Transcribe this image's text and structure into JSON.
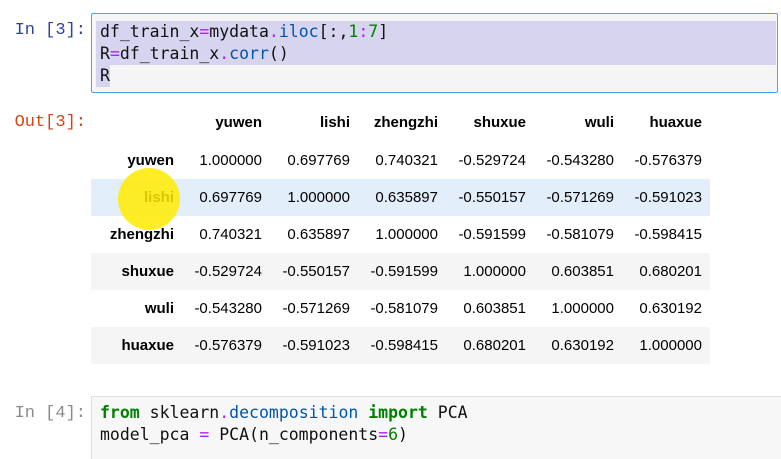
{
  "cells": [
    {
      "in_prompt": "In [3]:",
      "code_lines": [
        [
          "df_train_x",
          "=",
          "mydata",
          ".",
          "iloc",
          "[:,",
          "1",
          ":",
          "7",
          "]"
        ],
        [
          "R",
          "=",
          "df_train_x",
          ".",
          "corr",
          "()"
        ],
        [
          "R"
        ]
      ],
      "out_prompt": "Out[3]:",
      "output": {
        "columns": [
          "yuwen",
          "lishi",
          "zhengzhi",
          "shuxue",
          "wuli",
          "huaxue"
        ],
        "rows": [
          {
            "index": "yuwen",
            "values": [
              "1.000000",
              "0.697769",
              "0.740321",
              "-0.529724",
              "-0.543280",
              "-0.576379"
            ]
          },
          {
            "index": "lishi",
            "values": [
              "0.697769",
              "1.000000",
              "0.635897",
              "-0.550157",
              "-0.571269",
              "-0.591023"
            ]
          },
          {
            "index": "zhengzhi",
            "values": [
              "0.740321",
              "0.635897",
              "1.000000",
              "-0.591599",
              "-0.581079",
              "-0.598415"
            ]
          },
          {
            "index": "shuxue",
            "values": [
              "-0.529724",
              "-0.550157",
              "-0.591599",
              "1.000000",
              "0.603851",
              "0.680201"
            ]
          },
          {
            "index": "wuli",
            "values": [
              "-0.543280",
              "-0.571269",
              "-0.581079",
              "0.603851",
              "1.000000",
              "0.630192"
            ]
          },
          {
            "index": "huaxue",
            "values": [
              "-0.576379",
              "-0.591023",
              "-0.598415",
              "0.680201",
              "0.630192",
              "1.000000"
            ]
          }
        ]
      }
    },
    {
      "in_prompt": "In [4]:",
      "line1": {
        "kw1": "from",
        "mod": " sklearn",
        "dot": ".",
        "sub": "decomposition",
        "kw2": " import",
        "name": " PCA"
      },
      "line2": {
        "lhs": "model_pca ",
        "eq": "=",
        "call": " PCA(n_components",
        "eq2": "=",
        "num": "6",
        "close": ")"
      }
    }
  ],
  "colors": {
    "in_prompt": "#303f9f",
    "out_prompt": "#d84315",
    "active_cell_border": "#42a5f5",
    "selection": "#d7d4f0",
    "cursor_highlight": "#ffeb00"
  }
}
